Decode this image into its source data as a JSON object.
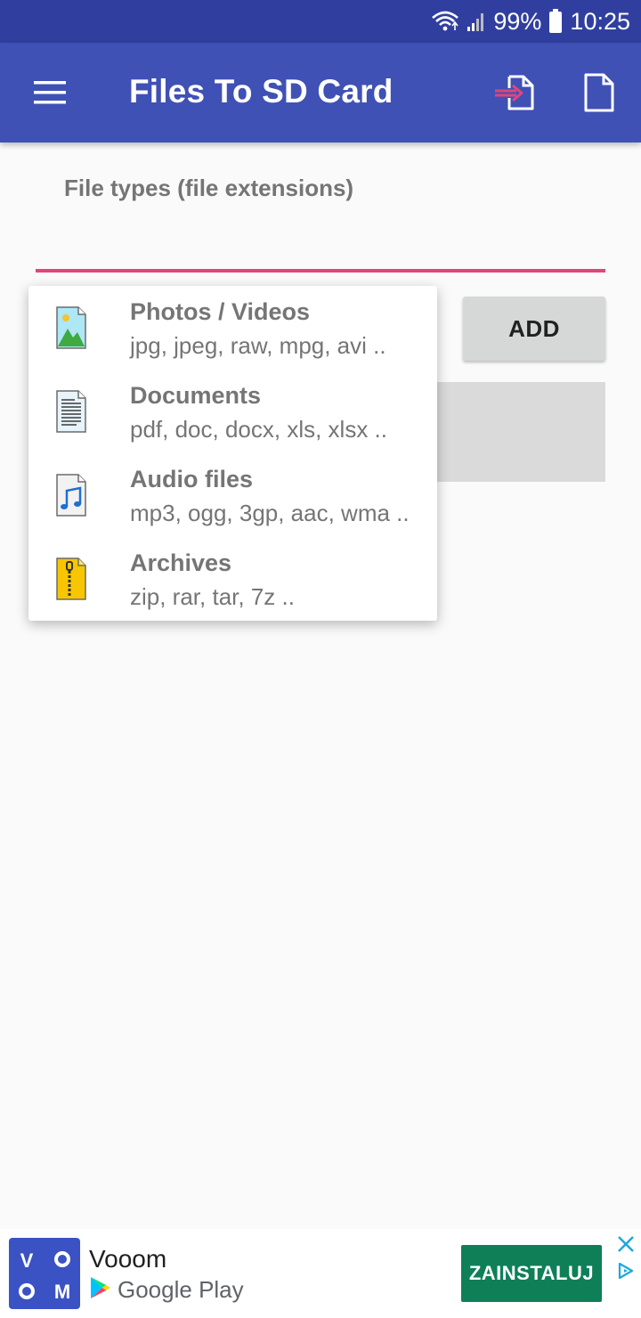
{
  "status": {
    "battery": "99%",
    "time": "10:25"
  },
  "appbar": {
    "title": "Files To SD Card"
  },
  "form": {
    "label": "File types (file extensions)",
    "input_value": "",
    "add_label": "ADD"
  },
  "dropdown": {
    "items": [
      {
        "title": "Photos / Videos",
        "subtitle": "jpg, jpeg, raw, mpg, avi ..",
        "icon": "image-file-icon"
      },
      {
        "title": "Documents",
        "subtitle": "pdf, doc, docx, xls, xlsx ..",
        "icon": "document-file-icon"
      },
      {
        "title": "Audio files",
        "subtitle": "mp3, ogg, 3gp, aac, wma  ..",
        "icon": "audio-file-icon"
      },
      {
        "title": "Archives",
        "subtitle": "zip, rar, tar, 7z ..",
        "icon": "archive-file-icon"
      }
    ]
  },
  "ad": {
    "app_name": "Vooom",
    "store_label": "Google Play",
    "install_label": "ZAINSTALUJ",
    "logo_letters": [
      "V",
      "O",
      "O",
      "M"
    ],
    "colors": {
      "install": "#0f7f58",
      "logo_bg": "#3b52c4"
    }
  },
  "colors": {
    "primary": "#3f51b5",
    "primary_dark": "#303f9f",
    "accent": "#e0457b"
  }
}
